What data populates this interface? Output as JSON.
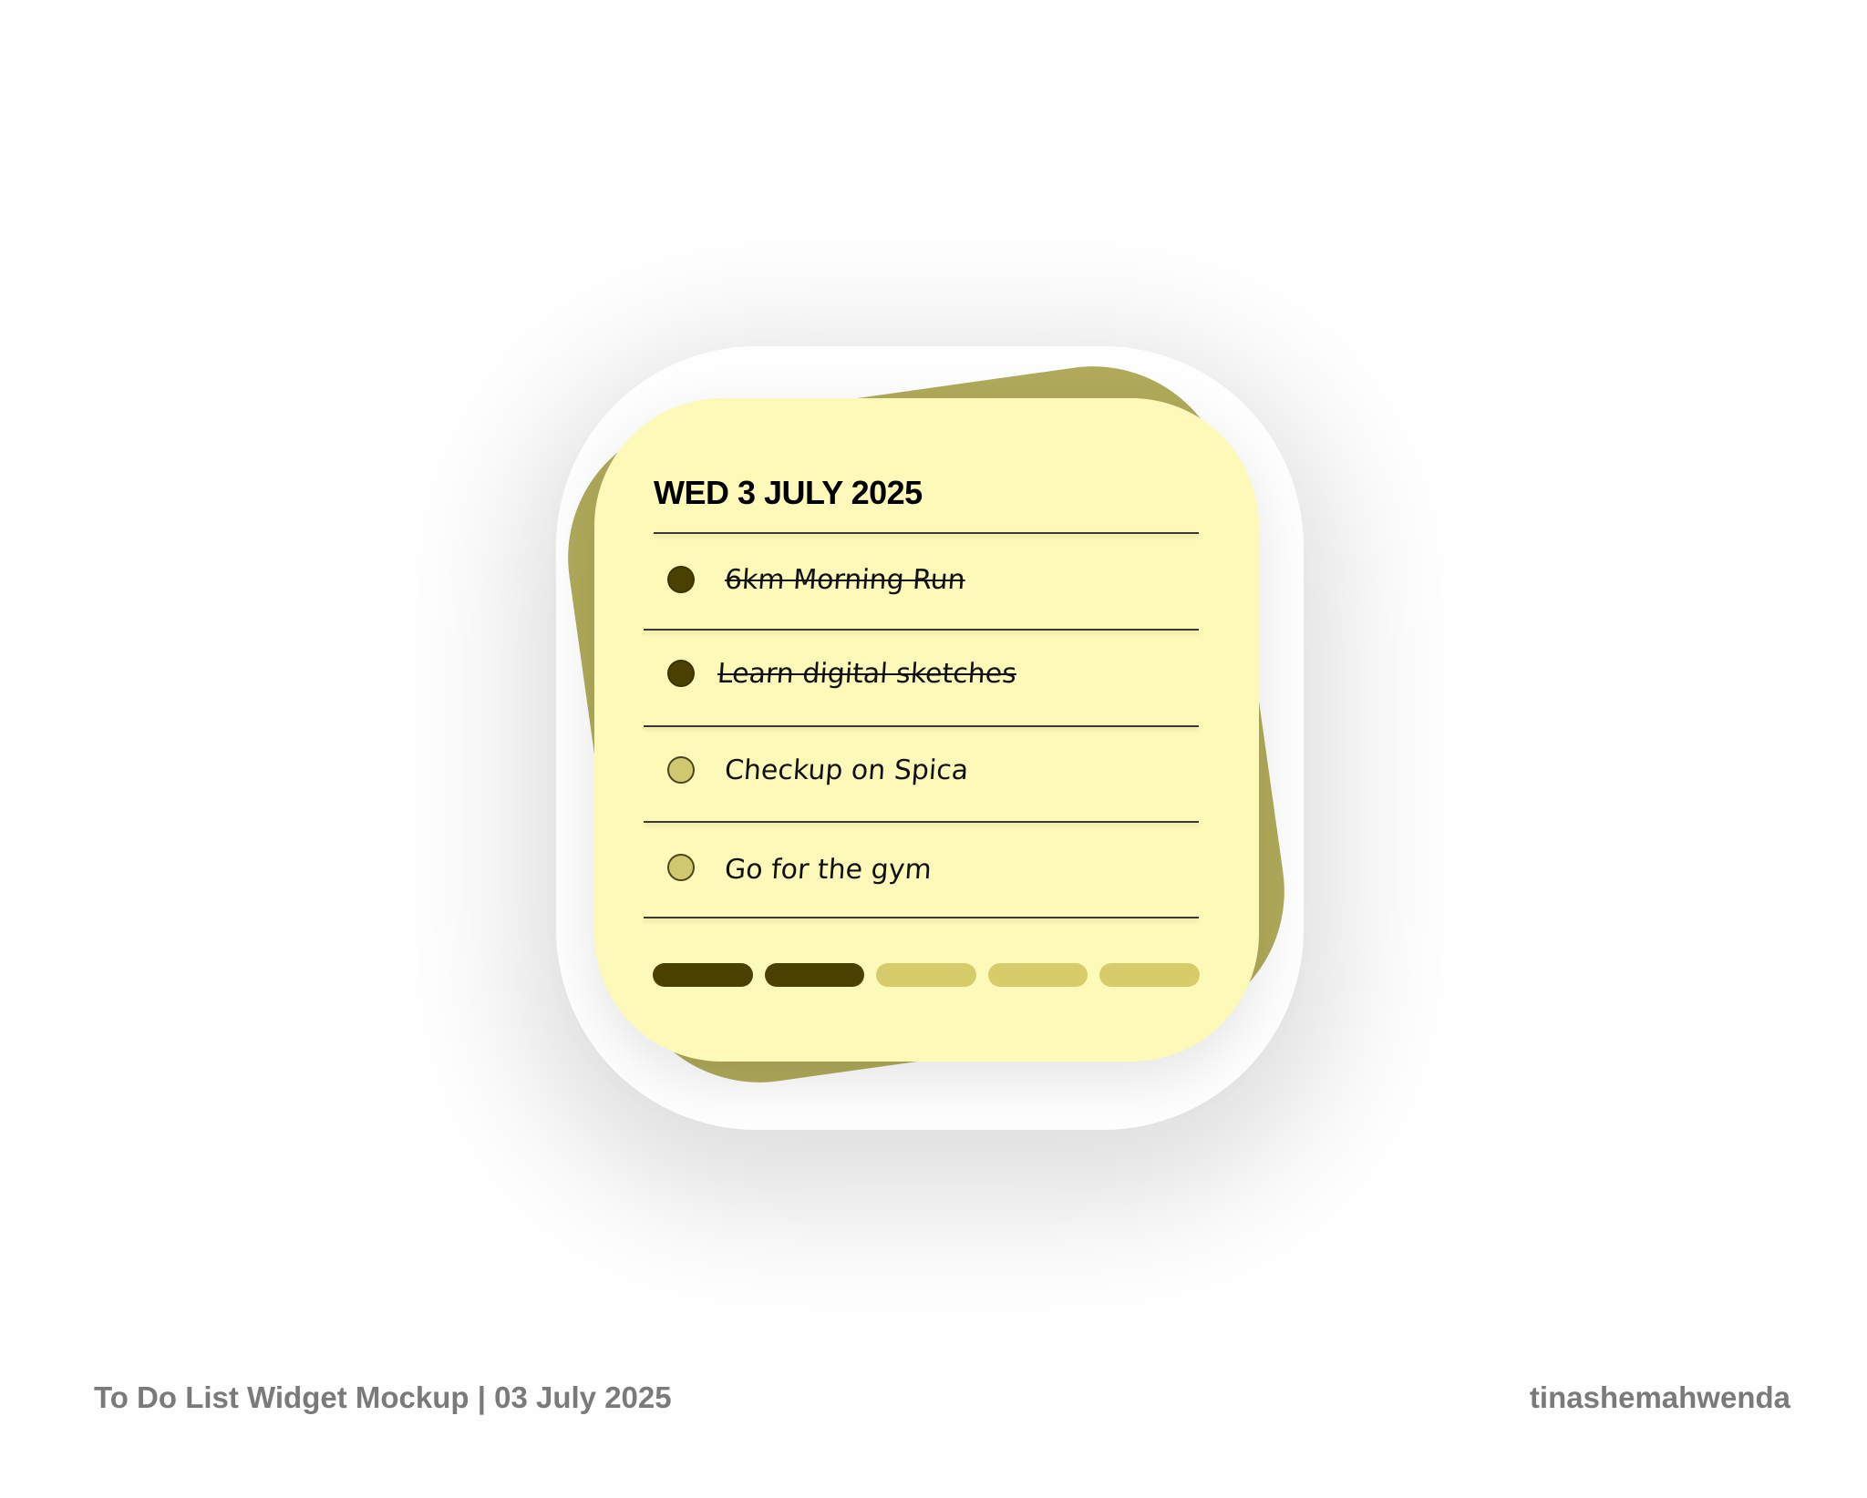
{
  "widget": {
    "date_title": "WED 3 JULY 2025",
    "tasks": [
      {
        "label": "6km Morning Run",
        "done": true
      },
      {
        "label": "Learn digital sketches",
        "done": true
      },
      {
        "label": "Checkup on Spica",
        "done": false
      },
      {
        "label": "Go for the gym",
        "done": false
      }
    ],
    "progress": {
      "completed": 2,
      "total": 5
    }
  },
  "colors": {
    "card_front": "#fdf9b9",
    "card_back": "#b0aa5a",
    "done_dot": "#4a4000",
    "todo_dot": "#d0c870",
    "progress_filled": "#4a4000",
    "progress_empty": "#d6cd6a"
  },
  "footer": {
    "caption": "To Do List Widget Mockup | 03 July 2025",
    "author": "tinashemahwenda"
  }
}
